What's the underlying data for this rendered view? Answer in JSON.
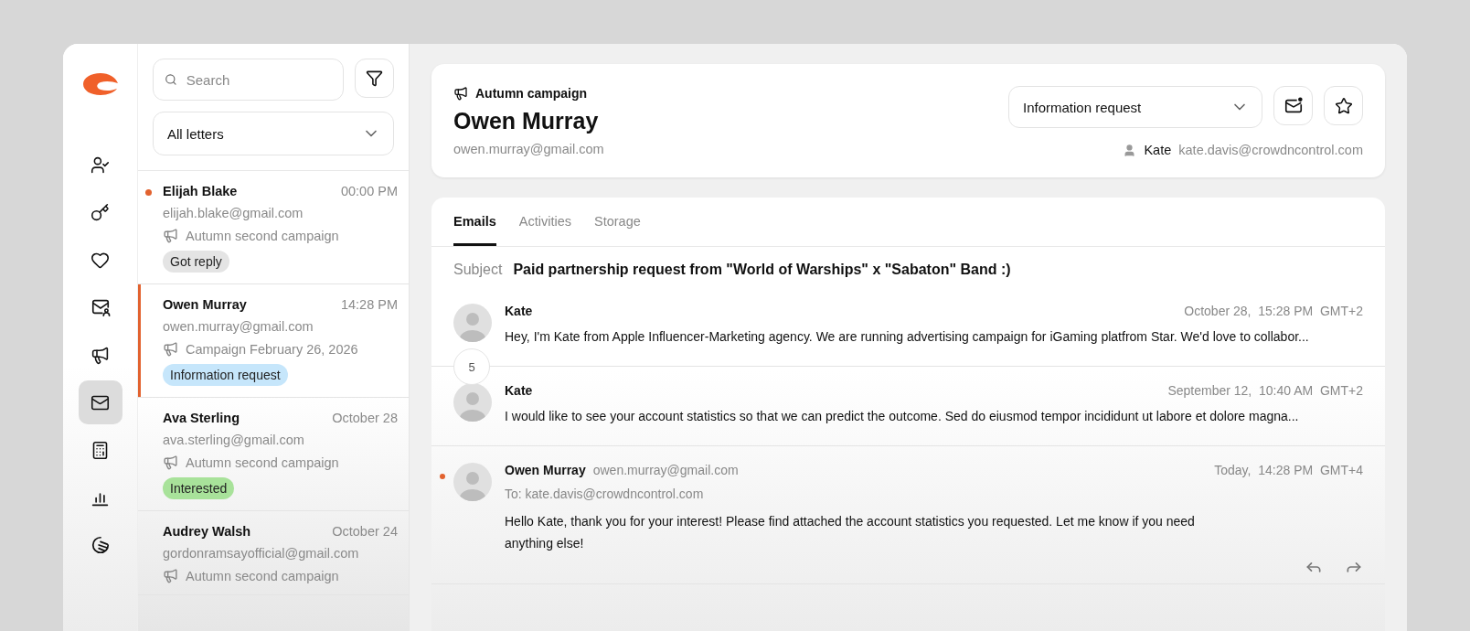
{
  "nav": {
    "items": [
      {
        "kind": "user-check",
        "selected": false
      },
      {
        "kind": "key",
        "selected": false
      },
      {
        "kind": "heart",
        "selected": false
      },
      {
        "kind": "mail-user",
        "selected": false
      },
      {
        "kind": "megaphone",
        "selected": false
      },
      {
        "kind": "mail",
        "selected": true
      },
      {
        "kind": "calculator",
        "selected": false
      },
      {
        "kind": "bars",
        "selected": false
      },
      {
        "kind": "circle-lines",
        "selected": false
      }
    ]
  },
  "list": {
    "search": {
      "placeholder": "Search"
    },
    "filter": {
      "value": "All letters"
    },
    "items": [
      {
        "name": "Elijah Blake",
        "time": "00:00 PM",
        "email": "elijah.blake@gmail.com",
        "campaign": "Autumn second campaign",
        "tag": "Got reply",
        "color": "#e4e4e4",
        "unread": true,
        "selected": false
      },
      {
        "name": "Owen Murray",
        "time": "14:28 PM",
        "email": "owen.murray@gmail.com",
        "campaign": "Campaign February 26, 2026",
        "tag": "Information request",
        "color": "#c6e6fb",
        "unread": false,
        "selected": true
      },
      {
        "name": "Ava Sterling",
        "time": "October 28",
        "email": "ava.sterling@gmail.com",
        "campaign": "Autumn second campaign",
        "tag": "Interested",
        "color": "#a8e29a",
        "unread": false,
        "selected": false
      },
      {
        "name": "Audrey Walsh",
        "time": "October 24",
        "email": "gordonramsayofficial@gmail.com",
        "campaign": "Autumn second campaign",
        "unread": false,
        "selected": false
      }
    ]
  },
  "contact": {
    "campaign": "Autumn campaign",
    "name": "Owen Murray",
    "email": "owen.murray@gmail.com",
    "status": "Information request",
    "manager": "Kate",
    "manager_email": "kate.davis@crowdncontrol.com"
  },
  "tabs": [
    {
      "label": "Emails",
      "selected": true
    },
    {
      "label": "Activities",
      "selected": false
    },
    {
      "label": "Storage",
      "selected": false
    }
  ],
  "thread": {
    "subject_label": "Subject",
    "subject": "Paid partnership request from \"World of Warships\" x \"Sabaton\" Band :)",
    "hidden_count": "5",
    "messages": [
      {
        "kind": "collapsed",
        "sender": "Kate",
        "date": "October 28,  15:28 PM  GMT+2",
        "text": "Hey, I'm Kate from Apple Influencer-Marketing agency. We are running advertising campaign for iGaming platfrom Star. We'd love to collabor...",
        "unread": false
      },
      {
        "kind": "collapsed",
        "sender": "Kate",
        "date": "September 12,  10:40 AM  GMT+2",
        "text": "I would like to see your account statistics so that we can predict the outcome. Sed do eiusmod tempor incididunt ut labore et dolore magna...",
        "unread": false
      },
      {
        "kind": "expanded",
        "sender": "Owen Murray",
        "sender_email": "owen.murray@gmail.com",
        "to": "To: kate.davis@crowdncontrol.com",
        "date": "Today,  14:28 PM  GMT+4",
        "text": "Hello Kate, thank you for your interest! Please find attached the account statistics you requested. Let me know if you need anything else!",
        "unread": true
      }
    ]
  }
}
